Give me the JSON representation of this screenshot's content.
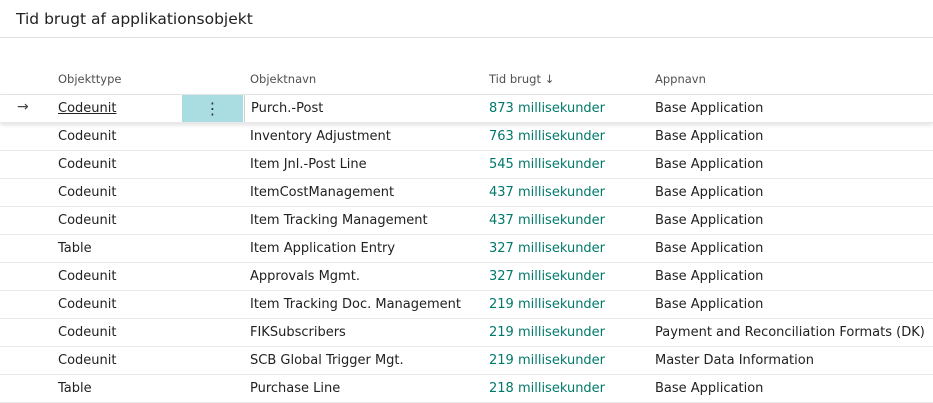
{
  "page": {
    "title": "Tid brugt af applikationsobjekt"
  },
  "columns": {
    "object_type": "Objekttype",
    "object_name": "Objektnavn",
    "time_spent": "Tid brugt",
    "sort_indicator": "↓",
    "app_name": "Appnavn"
  },
  "row_marker": "→",
  "action_glyph": "⋮",
  "rows": [
    {
      "type": "Codeunit",
      "name": "Purch.-Post",
      "time": "873 millisekunder",
      "app": "Base Application"
    },
    {
      "type": "Codeunit",
      "name": "Inventory Adjustment",
      "time": "763 millisekunder",
      "app": "Base Application"
    },
    {
      "type": "Codeunit",
      "name": "Item Jnl.-Post Line",
      "time": "545 millisekunder",
      "app": "Base Application"
    },
    {
      "type": "Codeunit",
      "name": "ItemCostManagement",
      "time": "437 millisekunder",
      "app": "Base Application"
    },
    {
      "type": "Codeunit",
      "name": "Item Tracking Management",
      "time": "437 millisekunder",
      "app": "Base Application"
    },
    {
      "type": "Table",
      "name": "Item Application Entry",
      "time": "327 millisekunder",
      "app": "Base Application"
    },
    {
      "type": "Codeunit",
      "name": "Approvals Mgmt.",
      "time": "327 millisekunder",
      "app": "Base Application"
    },
    {
      "type": "Codeunit",
      "name": "Item Tracking Doc. Management",
      "time": "219 millisekunder",
      "app": "Base Application"
    },
    {
      "type": "Codeunit",
      "name": "FIKSubscribers",
      "time": "219 millisekunder",
      "app": "Payment and Reconciliation Formats (DK)"
    },
    {
      "type": "Codeunit",
      "name": "SCB Global Trigger Mgt.",
      "time": "219 millisekunder",
      "app": "Master Data Information"
    },
    {
      "type": "Table",
      "name": "Purchase Line",
      "time": "218 millisekunder",
      "app": "Base Application"
    }
  ],
  "colors": {
    "accent": "#00796b",
    "selected_action_bg": "#a9dde2"
  }
}
